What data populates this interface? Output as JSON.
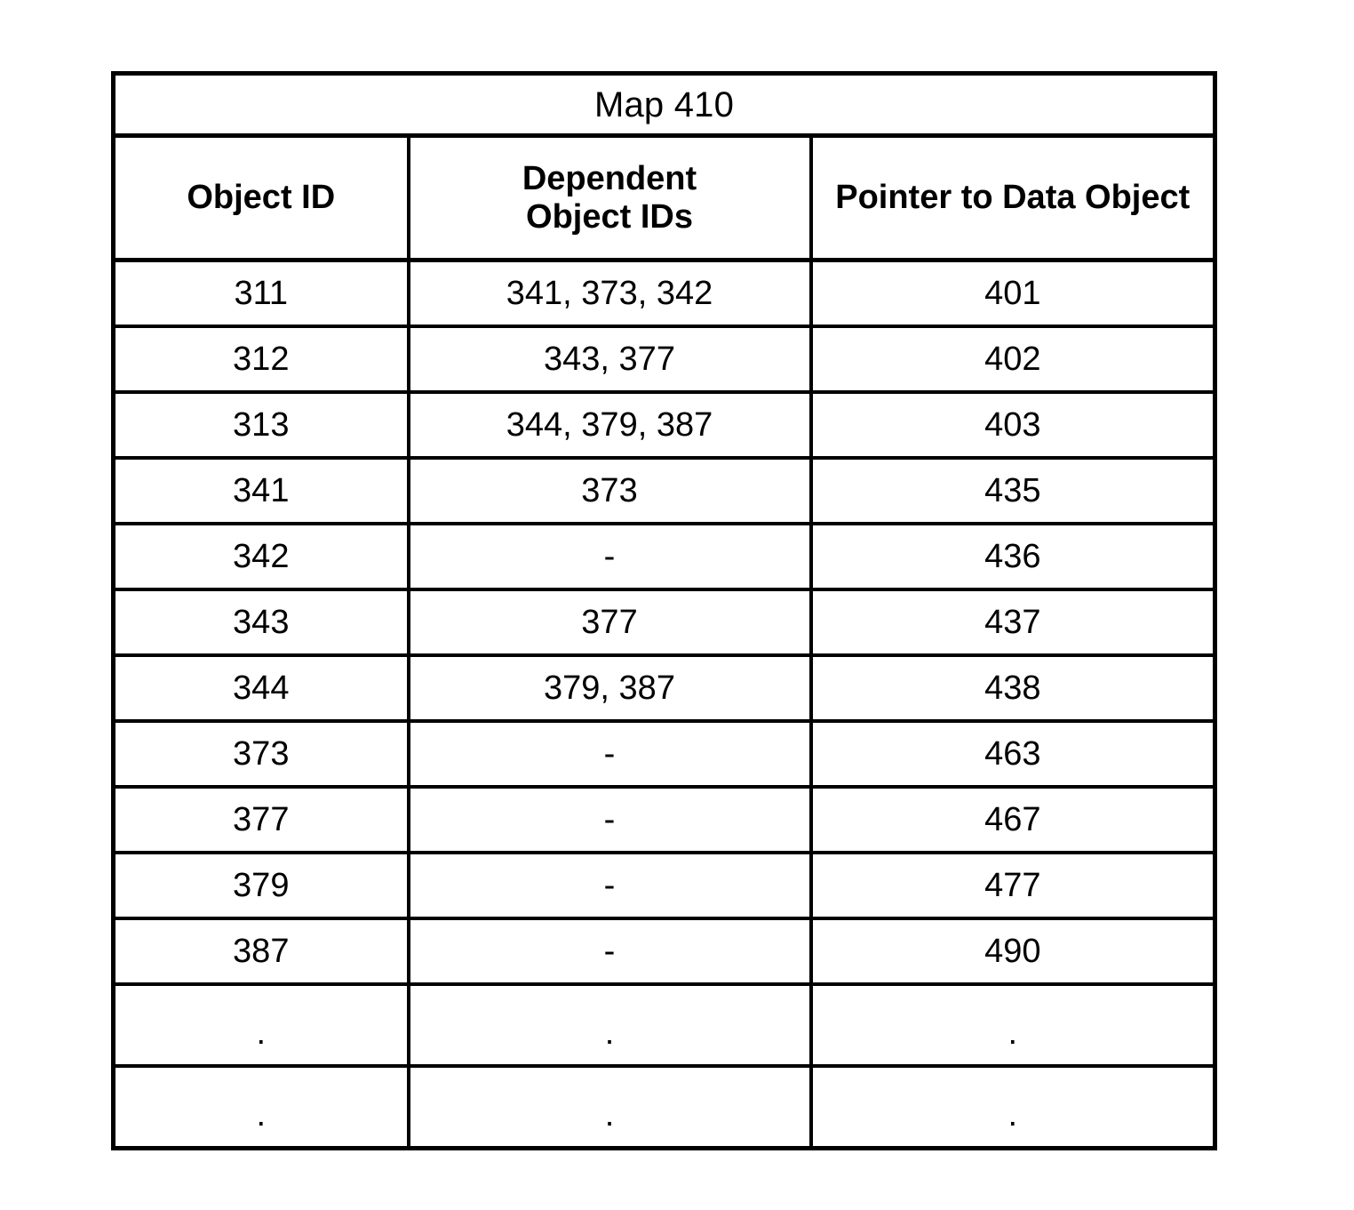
{
  "figure": {
    "title": "Map 410"
  },
  "table": {
    "columns": [
      {
        "key": "object_id",
        "label": "Object ID",
        "lines": [
          "Object ID"
        ]
      },
      {
        "key": "dependent_object_ids",
        "label": "Dependent Object IDs",
        "lines": [
          "Dependent",
          "Object IDs"
        ]
      },
      {
        "key": "pointer_to_data_object",
        "label": "Pointer to Data Object",
        "lines": [
          "Pointer to Data Object"
        ]
      }
    ],
    "rows": [
      {
        "object_id": "311",
        "dependent_object_ids": "341, 373, 342",
        "pointer_to_data_object": "401"
      },
      {
        "object_id": "312",
        "dependent_object_ids": "343, 377",
        "pointer_to_data_object": "402"
      },
      {
        "object_id": "313",
        "dependent_object_ids": "344, 379, 387",
        "pointer_to_data_object": "403"
      },
      {
        "object_id": "341",
        "dependent_object_ids": "373",
        "pointer_to_data_object": "435"
      },
      {
        "object_id": "342",
        "dependent_object_ids": "-",
        "pointer_to_data_object": "436"
      },
      {
        "object_id": "343",
        "dependent_object_ids": "377",
        "pointer_to_data_object": "437"
      },
      {
        "object_id": "344",
        "dependent_object_ids": "379, 387",
        "pointer_to_data_object": "438"
      },
      {
        "object_id": "373",
        "dependent_object_ids": "-",
        "pointer_to_data_object": "463"
      },
      {
        "object_id": "377",
        "dependent_object_ids": "-",
        "pointer_to_data_object": "467"
      },
      {
        "object_id": "379",
        "dependent_object_ids": "-",
        "pointer_to_data_object": "477"
      },
      {
        "object_id": "387",
        "dependent_object_ids": "-",
        "pointer_to_data_object": "490"
      },
      {
        "object_id": ".",
        "dependent_object_ids": ".",
        "pointer_to_data_object": "."
      },
      {
        "object_id": ".",
        "dependent_object_ids": ".",
        "pointer_to_data_object": "."
      }
    ]
  },
  "colors": {
    "ink": "#000000",
    "paper": "#ffffff"
  }
}
